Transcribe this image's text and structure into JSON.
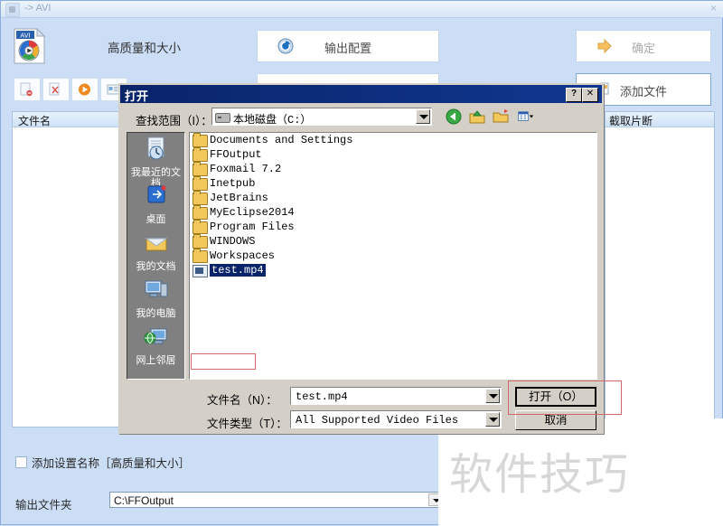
{
  "app": {
    "title": "-> AVI",
    "close_label": "×",
    "icon": "avi-video-icon",
    "preset_label": "高质量和大小",
    "buttons": {
      "output_config": "输出配置",
      "confirm": "确定",
      "add_file": "添加文件"
    },
    "toolbar_icons": [
      "remove-file-icon",
      "clear-list-icon",
      "play-icon",
      "properties-icon"
    ],
    "lists": {
      "left_header": "文件名",
      "right_header": "截取片断"
    },
    "add_setting_name_label": "添加设置名称［高质量和大小］",
    "add_setting_name_checked": false,
    "output_folder_label": "输出文件夹",
    "output_folder_value": "C:\\FFOutput"
  },
  "watermark": {
    "text": "软件技巧"
  },
  "dialog": {
    "title": "打开",
    "help_label": "?",
    "close_label": "✕",
    "lookin": {
      "label": "查找范围（I）：",
      "value": "本地磁盘（C:）",
      "icon": "hard-drive-icon"
    },
    "nav_icons": [
      "back-arrow-icon",
      "up-one-level-icon",
      "new-folder-icon",
      "views-icon"
    ],
    "places": [
      {
        "label": "我最近的文档",
        "icon": "recent-documents-icon"
      },
      {
        "label": "桌面",
        "icon": "desktop-icon"
      },
      {
        "label": "我的文档",
        "icon": "my-documents-icon"
      },
      {
        "label": "我的电脑",
        "icon": "my-computer-icon"
      },
      {
        "label": "网上邻居",
        "icon": "network-places-icon"
      }
    ],
    "files": [
      {
        "name": "Documents and Settings",
        "type": "folder",
        "selected": false
      },
      {
        "name": "FFOutput",
        "type": "folder",
        "selected": false
      },
      {
        "name": "Foxmail 7.2",
        "type": "folder",
        "selected": false
      },
      {
        "name": "Inetpub",
        "type": "folder",
        "selected": false
      },
      {
        "name": "JetBrains",
        "type": "folder",
        "selected": false
      },
      {
        "name": "MyEclipse2014",
        "type": "folder",
        "selected": false
      },
      {
        "name": "Program Files",
        "type": "folder",
        "selected": false
      },
      {
        "name": "WINDOWS",
        "type": "folder",
        "selected": false
      },
      {
        "name": "Workspaces",
        "type": "folder",
        "selected": false
      },
      {
        "name": "test.mp4",
        "type": "file",
        "selected": true
      }
    ],
    "filename": {
      "label": "文件名（N）：",
      "value": "test.mp4"
    },
    "filetype": {
      "label": "文件类型（T）：",
      "value": "All Supported Video Files"
    },
    "open_button": "打开（O）",
    "cancel_button": "取消"
  },
  "colors": {
    "app_bg": "#cbdef6",
    "dialog_face": "#d4d0c8",
    "dialog_title": "#0a246a",
    "highlight_red": "#d06a6a",
    "selection_blue": "#0a246a"
  }
}
